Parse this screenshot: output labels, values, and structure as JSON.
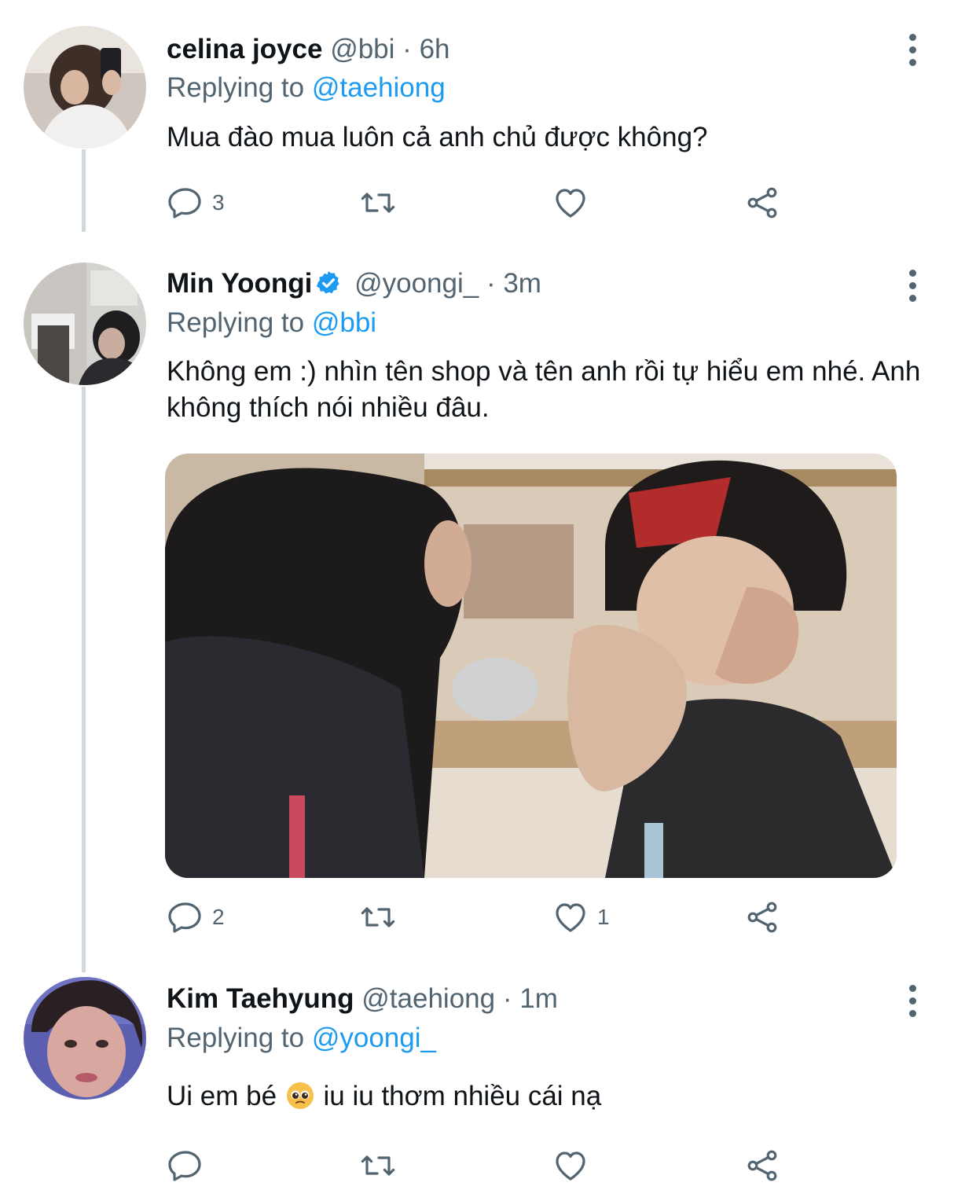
{
  "tweets": [
    {
      "name": "celina joyce",
      "handle": "@bbi",
      "time": "6h",
      "replying_label": "Replying to",
      "replying_handle": "@taehiong",
      "text": "Mua đào mua luôn cả anh chủ được không?",
      "reply_count": "3",
      "like_count": ""
    },
    {
      "name": "Min Yoongi",
      "verified": true,
      "handle": "@yoongi_",
      "time": "3m",
      "replying_label": "Replying to",
      "replying_handle": "@bbi",
      "text": "Không em :) nhìn tên shop và tên anh rồi tự hiểu em nhé. Anh không thích nói nhiều đâu.",
      "reply_count": "2",
      "like_count": "1"
    },
    {
      "name": "Kim Taehyung",
      "handle": "@taehiong",
      "time": "1m",
      "replying_label": "Replying to",
      "replying_handle": "@yoongi_",
      "text_before": "Ui em bé",
      "emoji": "pleading-face",
      "text_after": "iu iu thơm nhiều cái nạ",
      "reply_count": "",
      "like_count": ""
    }
  ],
  "separator": "·",
  "colors": {
    "link": "#1d9bf0",
    "secondary": "#536471",
    "thread_line": "#cfd9de",
    "verified": "#1d9bf0"
  },
  "icons": [
    "reply-icon",
    "retweet-icon",
    "like-icon",
    "share-icon",
    "more-icon",
    "verified-badge-icon"
  ]
}
